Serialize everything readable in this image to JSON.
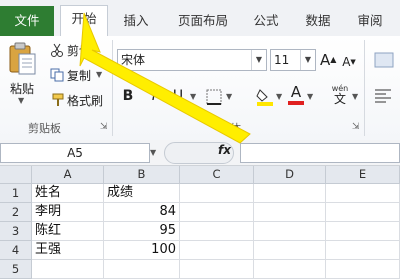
{
  "tabs": [
    {
      "id": "file",
      "label": "文件"
    },
    {
      "id": "home",
      "label": "开始"
    },
    {
      "id": "insert",
      "label": "插入"
    },
    {
      "id": "layout",
      "label": "页面布局"
    },
    {
      "id": "formulas",
      "label": "公式"
    },
    {
      "id": "data",
      "label": "数据"
    },
    {
      "id": "review",
      "label": "审阅"
    }
  ],
  "clipboard": {
    "paste_label": "粘贴",
    "cut_label": "剪切",
    "copy_label": "复制",
    "format_painter_label": "格式刷",
    "group_label": "剪贴板"
  },
  "font": {
    "font_name": "宋体",
    "font_size": "11",
    "bold": "B",
    "italic": "I",
    "underline": "U",
    "grow_label": "A",
    "shrink_label": "A",
    "wen_label": "wén",
    "font_color_label": "A",
    "group_label": "字体",
    "highlight_color": "#ffe600",
    "font_color": "#e02020"
  },
  "formula_bar": {
    "name_box": "A5",
    "fx_label": "fx",
    "formula": ""
  },
  "sheet": {
    "columns": [
      "A",
      "B",
      "C",
      "D",
      "E"
    ],
    "rows": [
      {
        "num": "1",
        "a": "姓名",
        "b": "成绩"
      },
      {
        "num": "2",
        "a": "李明",
        "b": "84"
      },
      {
        "num": "3",
        "a": "陈红",
        "b": "95"
      },
      {
        "num": "4",
        "a": "王强",
        "b": "100"
      },
      {
        "num": "5",
        "a": "",
        "b": ""
      }
    ]
  },
  "annotation": {
    "arrow_color": "#ffee00"
  }
}
